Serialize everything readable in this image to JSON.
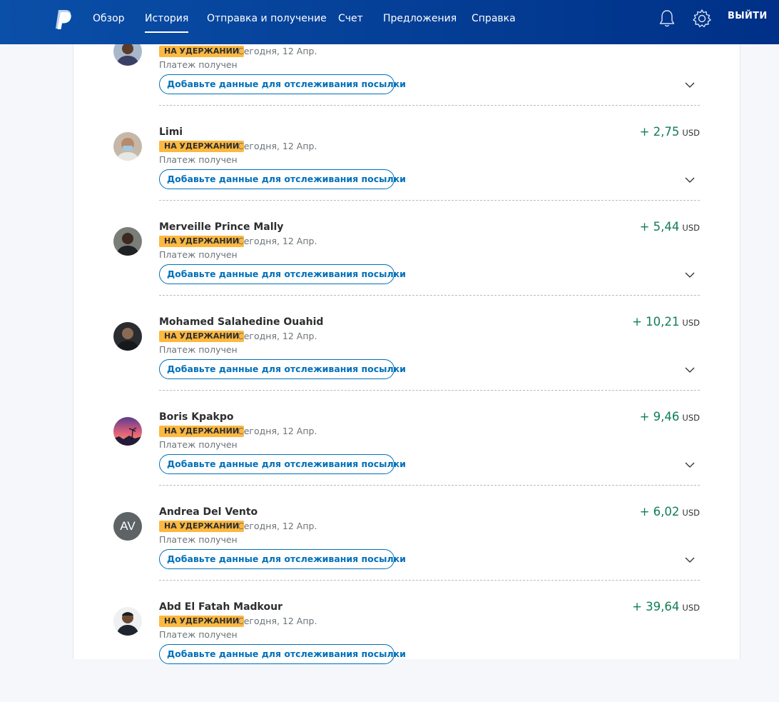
{
  "header": {
    "nav": [
      {
        "label": "Обзор"
      },
      {
        "label": "История",
        "active": true
      },
      {
        "label": "Отправка и получение"
      },
      {
        "label": "Счет"
      },
      {
        "label": "Предложения"
      },
      {
        "label": "Справка"
      }
    ],
    "icons": [
      "paypal-logo-icon",
      "bell-icon",
      "gear-icon"
    ],
    "logout_label": "ВЫЙТИ"
  },
  "colors": {
    "header": "#0a4fa8",
    "hold_badge": "#fdb840",
    "amount_positive": "#0e7e52",
    "link": "#0070ba"
  },
  "transactions": [
    {
      "name": "",
      "badge": "НА УДЕРЖАНИИ",
      "date": "Сегодня, 12 Апр.",
      "status": "Платеж получен",
      "amount": "",
      "currency": "",
      "track_label": "Добавьте данные для отслеживания посылки",
      "avatar": "photo"
    },
    {
      "name": "Limi",
      "badge": "НА УДЕРЖАНИИ",
      "date": "Сегодня, 12 Апр.",
      "status": "Платеж получен",
      "amount": "+ 2,75",
      "currency": "USD",
      "track_label": "Добавьте данные для отслеживания посылки",
      "avatar": "photo"
    },
    {
      "name": "Merveille Prince Mally",
      "badge": "НА УДЕРЖАНИИ",
      "date": "Сегодня, 12 Апр.",
      "status": "Платеж получен",
      "amount": "+ 5,44",
      "currency": "USD",
      "track_label": "Добавьте данные для отслеживания посылки",
      "avatar": "photo"
    },
    {
      "name": "Mohamed Salahedine Ouahid",
      "badge": "НА УДЕРЖАНИИ",
      "date": "Сегодня, 12 Апр.",
      "status": "Платеж получен",
      "amount": "+ 10,21",
      "currency": "USD",
      "track_label": "Добавьте данные для отслеживания посылки",
      "avatar": "photo"
    },
    {
      "name": "Boris Kpakpo",
      "badge": "НА УДЕРЖАНИИ",
      "date": "Сегодня, 12 Апр.",
      "status": "Платеж получен",
      "amount": "+ 9,46",
      "currency": "USD",
      "track_label": "Добавьте данные для отслеживания посылки",
      "avatar": "sunset"
    },
    {
      "name": "Andrea Del Vento",
      "badge": "НА УДЕРЖАНИИ",
      "date": "Сегодня, 12 Апр.",
      "status": "Платеж получен",
      "amount": "+ 6,02",
      "currency": "USD",
      "track_label": "Добавьте данные для отслеживания посылки",
      "avatar": "initials",
      "initials": "AV"
    },
    {
      "name": "Abd El Fatah Madkour",
      "badge": "НА УДЕРЖАНИИ",
      "date": "Сегодня, 12 Апр.",
      "status": "Платеж получен",
      "amount": "+ 39,64",
      "currency": "USD",
      "track_label": "Добавьте данные для отслеживания посылки",
      "avatar": "photo"
    }
  ]
}
